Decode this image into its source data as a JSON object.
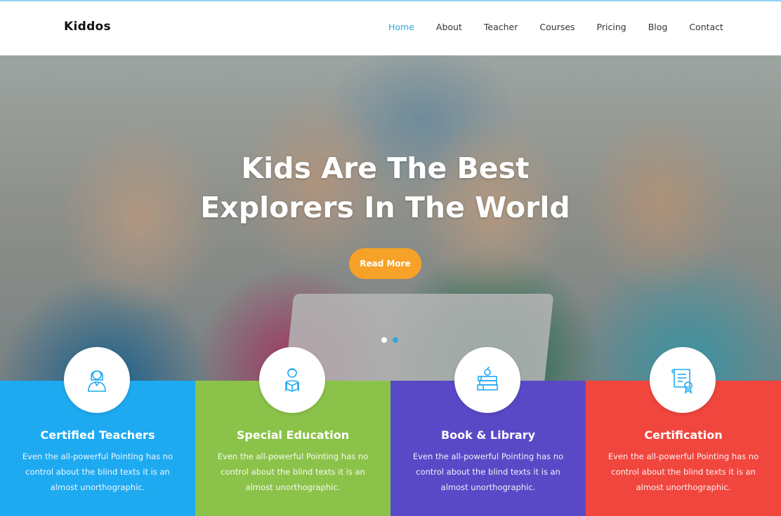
{
  "brand": "Kiddos",
  "nav": [
    {
      "label": "Home",
      "active": true
    },
    {
      "label": "About"
    },
    {
      "label": "Teacher"
    },
    {
      "label": "Courses"
    },
    {
      "label": "Pricing"
    },
    {
      "label": "Blog"
    },
    {
      "label": "Contact"
    }
  ],
  "hero": {
    "title_line1": "Kids Are The Best",
    "title_line2": "Explorers In The World",
    "cta_label": "Read More",
    "slides": 2,
    "active_slide": 2
  },
  "features": [
    {
      "title": "Certified Teachers",
      "text": "Even the all-powerful Pointing has no control about the blind texts it is an almost unorthographic.",
      "color": "#1eaaf1",
      "icon": "teacher-icon"
    },
    {
      "title": "Special Education",
      "text": "Even the all-powerful Pointing has no control about the blind texts it is an almost unorthographic.",
      "color": "#8bc34a",
      "icon": "reading-child-icon"
    },
    {
      "title": "Book & Library",
      "text": "Even the all-powerful Pointing has no control about the blind texts it is an almost unorthographic.",
      "color": "#5a49c7",
      "icon": "books-icon"
    },
    {
      "title": "Certification",
      "text": "Even the all-powerful Pointing has no control about the blind texts it is an almost unorthographic.",
      "color": "#f0463e",
      "icon": "certificate-icon"
    }
  ],
  "colors": {
    "accent": "#2ea8df",
    "cta": "#f6a228"
  }
}
